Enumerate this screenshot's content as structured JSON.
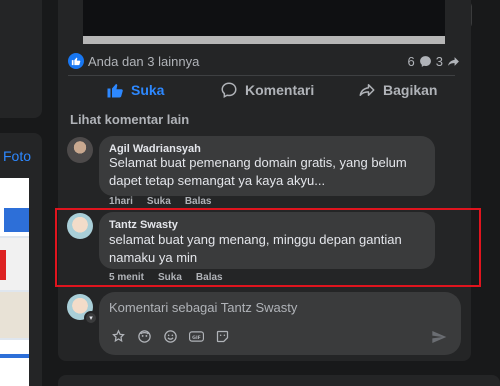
{
  "header": {
    "more_label": "•••"
  },
  "sidebar": {
    "photo_link": "Foto"
  },
  "post": {
    "reactions_text": "Anda dan 3 lainnya",
    "comment_count": "6",
    "share_count": "3",
    "actions": {
      "like": "Suka",
      "comment": "Komentari",
      "share": "Bagikan"
    }
  },
  "comments": {
    "see_more": "Lihat komentar lain",
    "items": [
      {
        "author": "Agil Wadriansyah",
        "text": "Selamat buat pemenang domain gratis, yang belum dapet tetap semangat ya kaya akyu...",
        "time": "1hari",
        "like": "Suka",
        "reply": "Balas"
      },
      {
        "author": "Tantz Swasty",
        "text": "selamat buat yang menang, minggu depan gantian namaku ya min",
        "time": "5 menit",
        "like": "Suka",
        "reply": "Balas"
      }
    ]
  },
  "composer": {
    "placeholder": "Komentari sebagai Tantz Swasty",
    "tools": [
      "sticker-icon",
      "avatar-sticker-icon",
      "emoji-icon",
      "gif-icon",
      "sticker-face-icon"
    ],
    "send_icon": "send-icon"
  },
  "colors": {
    "accent": "#2d88ff",
    "highlight": "#e0141e",
    "card": "#242526",
    "bubble": "#3a3b3c"
  }
}
